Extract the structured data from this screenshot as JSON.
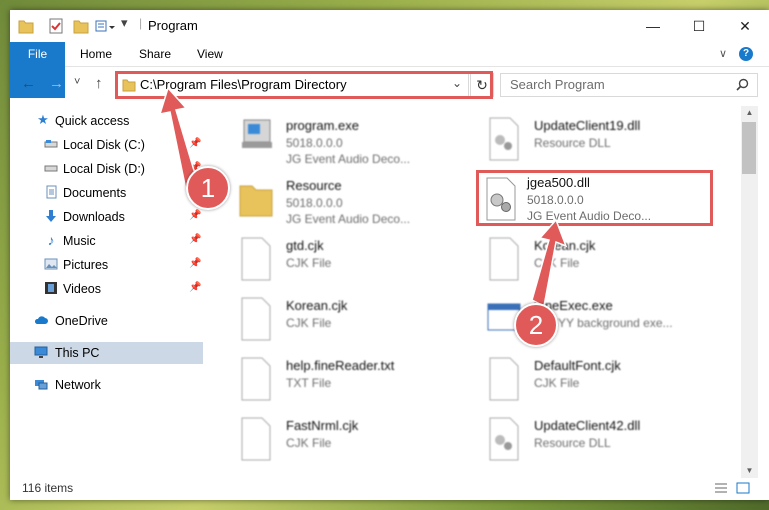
{
  "window": {
    "title": "Program",
    "minimize_glyph": "—",
    "maximize_glyph": "☐",
    "close_glyph": "✕"
  },
  "ribbon": {
    "tabs": [
      {
        "label": "File"
      },
      {
        "label": "Home"
      },
      {
        "label": "Share"
      },
      {
        "label": "View"
      }
    ],
    "help_glyph": "?",
    "expand_glyph": "∨"
  },
  "navigation": {
    "back_glyph": "←",
    "forward_glyph": "→",
    "recent_glyph": "˅",
    "up_glyph": "↑",
    "address": "C:\\Program Files\\Program Directory",
    "search_placeholder": "Search Program",
    "refresh_glyph": "↻",
    "dropdown_glyph": "⌄"
  },
  "sidebar": {
    "items": [
      {
        "label": "Quick access",
        "icon": "star-icon"
      },
      {
        "label": "Local Disk (C:)",
        "icon": "drive-icon"
      },
      {
        "label": "Local Disk (D:)",
        "icon": "drive-icon"
      },
      {
        "label": "Documents",
        "icon": "documents-icon"
      },
      {
        "label": "Downloads",
        "icon": "download-icon"
      },
      {
        "label": "Music",
        "icon": "music-icon"
      },
      {
        "label": "Pictures",
        "icon": "pictures-icon"
      },
      {
        "label": "Videos",
        "icon": "videos-icon"
      },
      {
        "label": "OneDrive",
        "icon": "cloud-icon"
      },
      {
        "label": "This PC",
        "icon": "computer-icon"
      },
      {
        "label": "Network",
        "icon": "network-icon"
      }
    ]
  },
  "files": [
    {
      "name": "program.exe",
      "line2": "5018.0.0.0",
      "line3": "JG Event Audio Deco...",
      "icon": "exe-icon"
    },
    {
      "name": "UpdateClient19.dll",
      "line2": "Resource DLL",
      "line3": "",
      "icon": "dll-icon"
    },
    {
      "name": "Resource",
      "line2": "5018.0.0.0",
      "line3": "JG Event Audio Deco...",
      "icon": "folder-icon"
    },
    {
      "name": "jgea500.dll",
      "line2": "5018.0.0.0",
      "line3": "JG Event Audio Deco...",
      "icon": "dll-icon"
    },
    {
      "name": "gtd.cjk",
      "line2": "CJK File",
      "line3": "",
      "icon": "file-icon"
    },
    {
      "name": "Korean.cjk",
      "line2": "CJK File",
      "line3": "",
      "icon": "file-icon"
    },
    {
      "name": "Korean.cjk",
      "line2": "CJK File",
      "line3": "",
      "icon": "file-icon"
    },
    {
      "name": "FineExec.exe",
      "line2": "ABBYY background exe...",
      "line3": "",
      "icon": "window-exe-icon"
    },
    {
      "name": "help.fineReader.txt",
      "line2": "TXT File",
      "line3": "",
      "icon": "file-icon"
    },
    {
      "name": "DefaultFont.cjk",
      "line2": "CJK File",
      "line3": "",
      "icon": "file-icon"
    },
    {
      "name": "FastNrml.cjk",
      "line2": "CJK File",
      "line3": "",
      "icon": "file-icon"
    },
    {
      "name": "UpdateClient42.dll",
      "line2": "Resource DLL",
      "line3": "",
      "icon": "dll-icon"
    }
  ],
  "status": {
    "item_count": "116 items"
  },
  "callouts": {
    "step1": "1",
    "step2": "2"
  },
  "colors": {
    "accent": "#1979ca",
    "annotation_red": "#e05a5a",
    "selection": "#ccd8e6"
  }
}
